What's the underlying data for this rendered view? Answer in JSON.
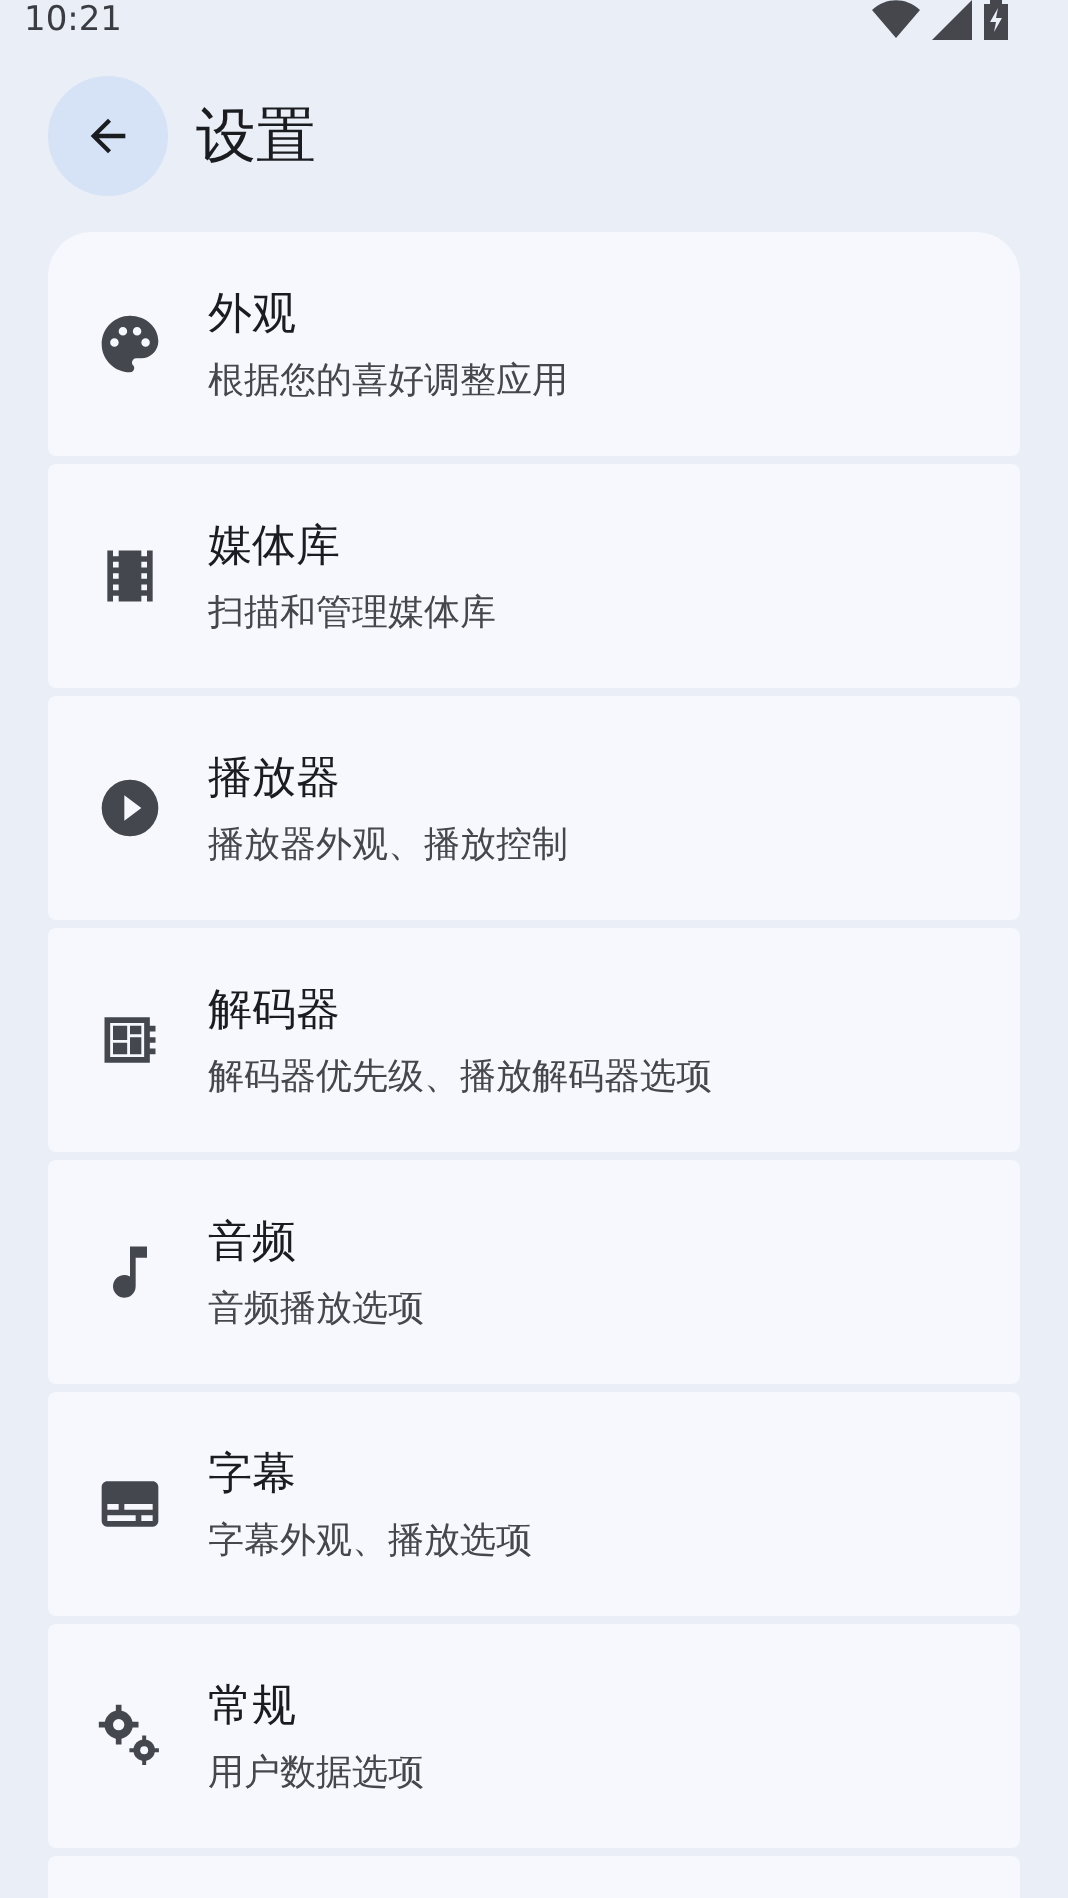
{
  "status_bar": {
    "time": "10:21"
  },
  "header": {
    "title": "设置"
  },
  "items": [
    {
      "kind": "palette",
      "title": "外观",
      "subtitle": "根据您的喜好调整应用"
    },
    {
      "kind": "film",
      "title": "媒体库",
      "subtitle": "扫描和管理媒体库"
    },
    {
      "kind": "play",
      "title": "播放器",
      "subtitle": "播放器外观、播放控制"
    },
    {
      "kind": "chip",
      "title": "解码器",
      "subtitle": "解码器优先级、播放解码器选项"
    },
    {
      "kind": "note",
      "title": "音频",
      "subtitle": "音频播放选项"
    },
    {
      "kind": "subtitles",
      "title": "字幕",
      "subtitle": "字幕外观、播放选项"
    },
    {
      "kind": "gears",
      "title": "常规",
      "subtitle": "用户数据选项"
    }
  ]
}
